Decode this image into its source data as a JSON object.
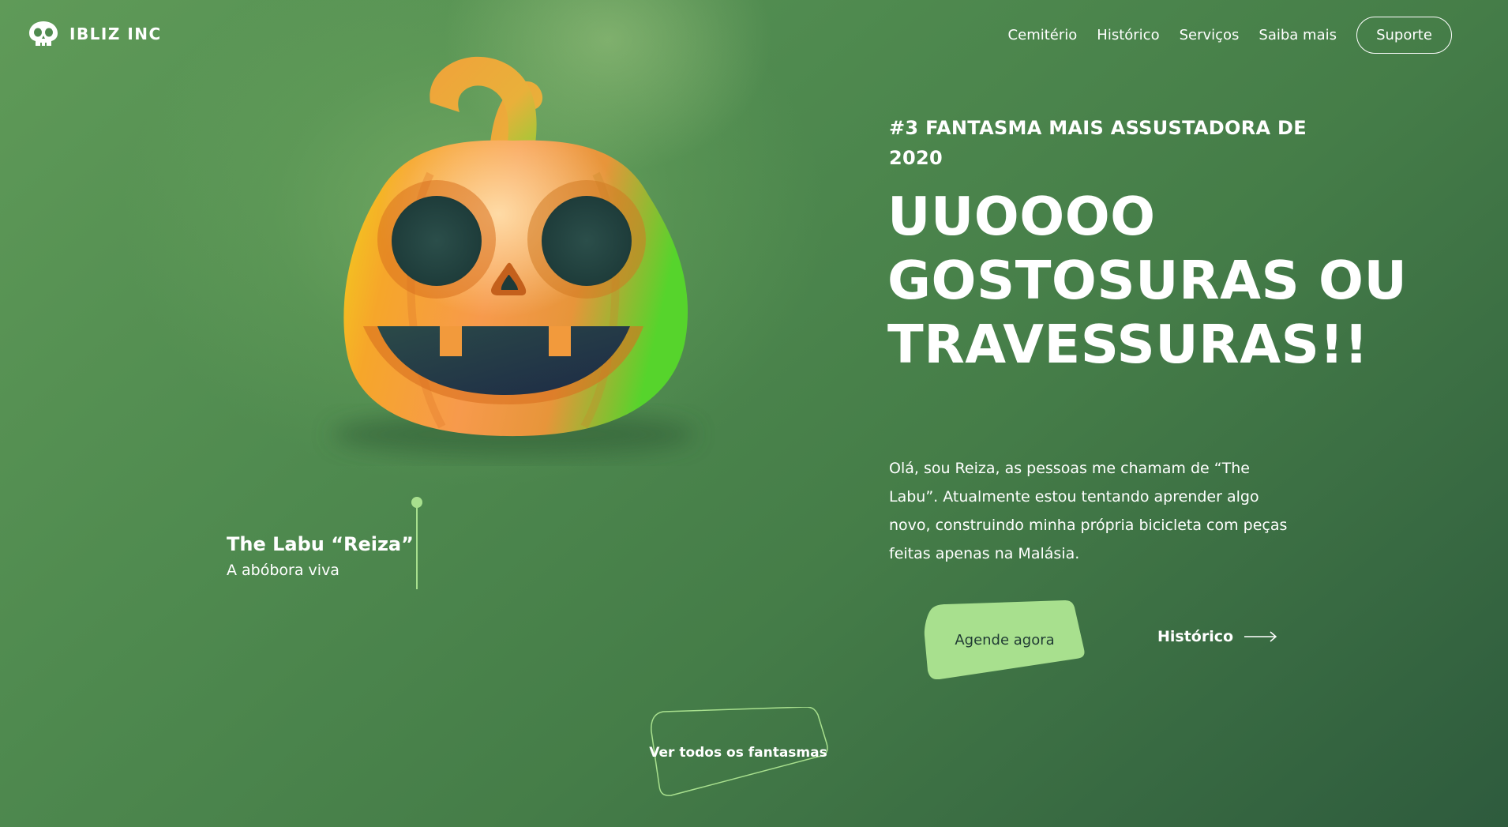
{
  "brand": {
    "name": "IBLIZ INC",
    "icon": "skull-icon"
  },
  "nav": {
    "items": [
      "Cemitério",
      "Histórico",
      "Serviços",
      "Saiba mais"
    ],
    "support_label": "Suporte"
  },
  "hero": {
    "illustration": "pumpkin-icon",
    "kicker": "#3 FANTASMA MAIS ASSUSTADORA DE 2020",
    "headline": "UUOOOO GOSTOSURAS OU TRAVESSURAS!!",
    "intro": "Olá, sou Reiza, as pessoas me chamam de “The Labu”. Atualmente estou tentando aprender algo novo, construindo minha própria bicicleta com peças feitas apenas na Malásia."
  },
  "caption": {
    "name": "The Labu “Reiza”",
    "subtitle": "A abóbora viva"
  },
  "actions": {
    "schedule_label": "Agende agora",
    "history_label": "Histórico",
    "history_icon": "arrow-right-icon",
    "view_all_label": "Ver todos os fantasmas"
  },
  "colors": {
    "accent": "#a8e08e",
    "background": "#4f8a4f",
    "button_text": "#1f3a33"
  }
}
